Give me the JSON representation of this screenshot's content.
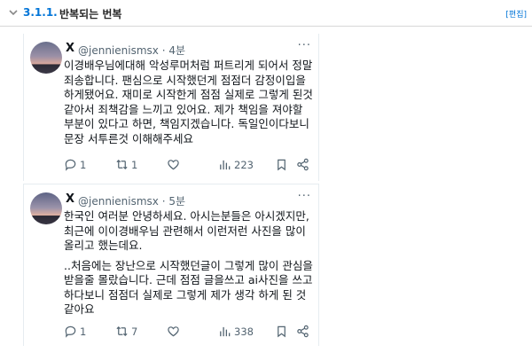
{
  "section": {
    "number": "3.1.1.",
    "title": "반복되는 번복",
    "edit_label": "[편집]"
  },
  "tweets": [
    {
      "name": "X",
      "handle": "@jennienismsx · 4분",
      "paragraphs": [
        "이경배우님에대해 악성루머처럼 퍼트리게 되어서 정말 죄송합니다. 팬심으로 시작했던게 점점더 감정이입을 하게됐어요. 재미로 시작한게 점점 실제로 그렇게 된것 같아서 죄책감을 느끼고 있어요. 제가 책임을 져야할 부분이 있다고 하면, 책임지겠습니다. 독일인이다보니 문장 서투른것 이해해주세요"
      ],
      "replies": "1",
      "retweets": "1",
      "likes": "",
      "views": "223"
    },
    {
      "name": "X",
      "handle": "@jennienismsx · 5분",
      "paragraphs": [
        "한국인 여러분 안녕하세요. 아시는분들은 아시겠지만, 최근에 이이경배우님 관련해서 이런저런 사진을 많이 올리고 했는데요.",
        "..처음에는 장난으로 시작했던글이 그렇게 많이 관심을 받을줄 몰랐습니다. 근데 점점 글을쓰고 ai사진을 쓰고 하다보니 점점더 실제로 그렇게 제가 생각 하게 된 것 같아요"
      ],
      "replies": "1",
      "retweets": "7",
      "likes": "",
      "views": "338"
    }
  ]
}
